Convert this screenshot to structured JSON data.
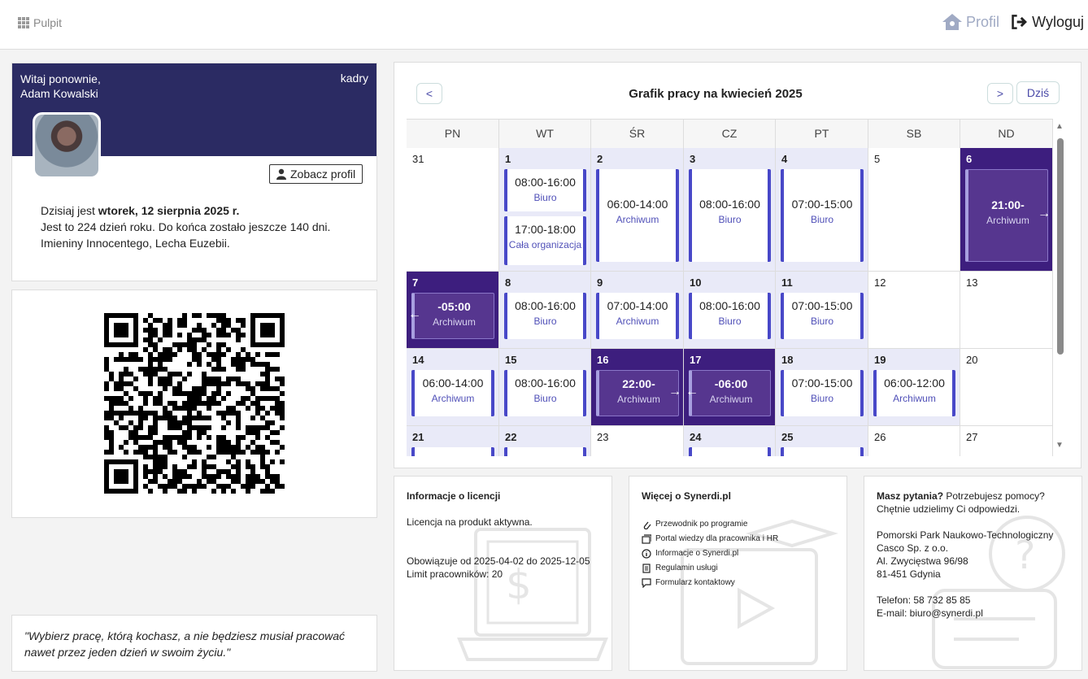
{
  "topbar": {
    "pulpit": "Pulpit",
    "profil": "Profil",
    "wyloguj": "Wyloguj"
  },
  "welcome": {
    "greeting_line1": "Witaj ponownie,",
    "greeting_line2": "Adam Kowalski",
    "role": "kadry",
    "see_profile": "Zobacz profil",
    "today_prefix": "Dzisiaj jest ",
    "today_date": "wtorek, 12 sierpnia 2025 r.",
    "day_of_year": "Jest to 224 dzień roku. Do końca zostało jeszcze 140 dni.",
    "namedays": "Imieniny Innocentego, Lecha Euzebii."
  },
  "quote": "\"Wybierz pracę, którą kochasz, a nie będziesz musiał pracować nawet przez jeden dzień w swoim życiu.\"",
  "calendar": {
    "title": "Grafik pracy na kwiecień 2025",
    "prev": "<",
    "next": ">",
    "today": "Dziś",
    "weekdays": [
      "PN",
      "WT",
      "ŚR",
      "CZ",
      "PT",
      "SB",
      "ND"
    ],
    "weeks": [
      [
        {
          "day": "31",
          "style": "plain",
          "events": []
        },
        {
          "day": "1",
          "style": "light",
          "events": [
            {
              "time": "08:00-16:00",
              "label": "Biuro"
            },
            {
              "time": "17:00-18:00",
              "label": "Cała organizacja"
            }
          ]
        },
        {
          "day": "2",
          "style": "light",
          "events": [
            {
              "time": "06:00-14:00",
              "label": "Archiwum"
            }
          ]
        },
        {
          "day": "3",
          "style": "light",
          "events": [
            {
              "time": "08:00-16:00",
              "label": "Biuro"
            }
          ]
        },
        {
          "day": "4",
          "style": "light",
          "events": [
            {
              "time": "07:00-15:00",
              "label": "Biuro"
            }
          ]
        },
        {
          "day": "5",
          "style": "plain",
          "events": []
        },
        {
          "day": "6",
          "style": "dark",
          "events": [
            {
              "time": "21:00-",
              "label": "Archiwum",
              "arrow": "→"
            }
          ]
        }
      ],
      [
        {
          "day": "7",
          "style": "dark",
          "events": [
            {
              "time": "-05:00",
              "label": "Archiwum",
              "arrow": "←"
            }
          ]
        },
        {
          "day": "8",
          "style": "light",
          "events": [
            {
              "time": "08:00-16:00",
              "label": "Biuro"
            }
          ]
        },
        {
          "day": "9",
          "style": "light",
          "events": [
            {
              "time": "07:00-14:00",
              "label": "Archiwum"
            }
          ]
        },
        {
          "day": "10",
          "style": "light",
          "events": [
            {
              "time": "08:00-16:00",
              "label": "Biuro"
            }
          ]
        },
        {
          "day": "11",
          "style": "light",
          "events": [
            {
              "time": "07:00-15:00",
              "label": "Biuro"
            }
          ]
        },
        {
          "day": "12",
          "style": "plain",
          "events": []
        },
        {
          "day": "13",
          "style": "plain",
          "events": []
        }
      ],
      [
        {
          "day": "14",
          "style": "light",
          "events": [
            {
              "time": "06:00-14:00",
              "label": "Archiwum"
            }
          ]
        },
        {
          "day": "15",
          "style": "light",
          "events": [
            {
              "time": "08:00-16:00",
              "label": "Biuro"
            }
          ]
        },
        {
          "day": "16",
          "style": "dark",
          "events": [
            {
              "time": "22:00-",
              "label": "Archiwum",
              "arrow": "→"
            }
          ]
        },
        {
          "day": "17",
          "style": "dark",
          "events": [
            {
              "time": "-06:00",
              "label": "Archiwum",
              "arrow": "←"
            }
          ]
        },
        {
          "day": "18",
          "style": "light",
          "events": [
            {
              "time": "07:00-15:00",
              "label": "Biuro"
            }
          ]
        },
        {
          "day": "19",
          "style": "light",
          "events": [
            {
              "time": "06:00-12:00",
              "label": "Archiwum"
            }
          ]
        },
        {
          "day": "20",
          "style": "plain",
          "events": []
        }
      ],
      [
        {
          "day": "21",
          "style": "light",
          "events": [
            {
              "time": "",
              "label": ""
            }
          ]
        },
        {
          "day": "22",
          "style": "light",
          "events": [
            {
              "time": "",
              "label": ""
            }
          ]
        },
        {
          "day": "23",
          "style": "plain",
          "events": []
        },
        {
          "day": "24",
          "style": "light",
          "events": [
            {
              "time": "",
              "label": ""
            }
          ]
        },
        {
          "day": "25",
          "style": "light",
          "events": [
            {
              "time": "",
              "label": ""
            }
          ]
        },
        {
          "day": "26",
          "style": "plain",
          "events": []
        },
        {
          "day": "27",
          "style": "plain",
          "events": []
        }
      ]
    ]
  },
  "license": {
    "title": "Informacje o licencji",
    "status": "Licencja na produkt aktywna.",
    "valid": "Obowiązuje od 2025-04-02 do 2025-12-05",
    "limit": "Limit pracowników: 20"
  },
  "more": {
    "title": "Więcej o Synerdi.pl",
    "links": [
      {
        "icon": "paperclip-icon",
        "label": "Przewodnik po programie"
      },
      {
        "icon": "book-icon",
        "label": "Portal wiedzy dla pracownika i HR"
      },
      {
        "icon": "info-icon",
        "label": "Informacje o Synerdi.pl"
      },
      {
        "icon": "document-icon",
        "label": "Regulamin usługi"
      },
      {
        "icon": "chat-icon",
        "label": "Formularz kontaktowy"
      }
    ]
  },
  "contact": {
    "question_bold": "Masz pytania?",
    "question_rest": " Potrzebujesz pomocy? Chętnie udzielimy Ci odpowiedzi.",
    "company1": "Pomorski Park Naukowo-Technologiczny",
    "company2": "Casco Sp. z o.o.",
    "street": "Al. Zwycięstwa 96/98",
    "city": "81-451 Gdynia",
    "phone": "Telefon: 58 732 85 85",
    "email": "E-mail: biuro@synerdi.pl"
  },
  "colors": {
    "header_navy": "#2b2b63",
    "event_border": "#4848c8",
    "dark_cell": "#3d1e7e",
    "light_cell": "#e9eaf8"
  }
}
